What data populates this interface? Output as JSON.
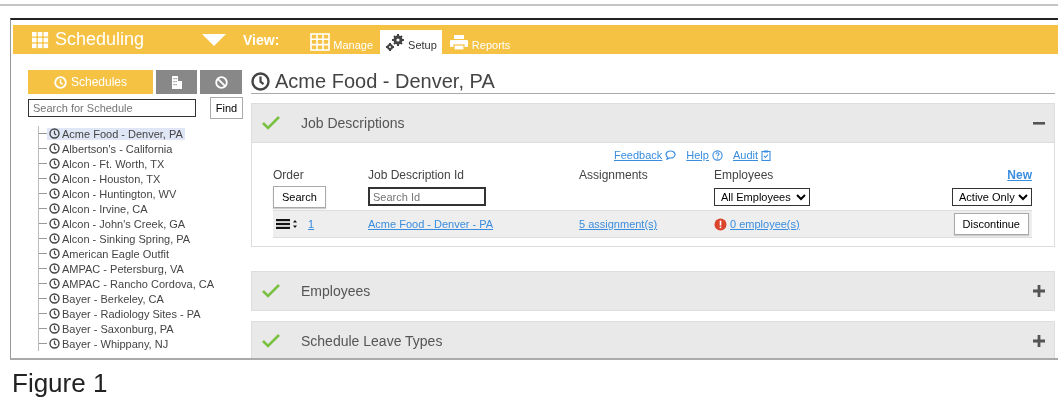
{
  "app": {
    "title": "Scheduling",
    "view_label": "View:",
    "view_tabs": [
      {
        "label": "Manage",
        "kind": "grid",
        "selected": false
      },
      {
        "label": "Setup",
        "kind": "gears",
        "selected": true
      },
      {
        "label": "Reports",
        "kind": "printer",
        "selected": false
      }
    ]
  },
  "sidebar": {
    "tabs": [
      {
        "kind": "text",
        "label": "Schedules",
        "selected": true
      },
      {
        "kind": "building",
        "selected": false
      },
      {
        "kind": "ban",
        "selected": false
      }
    ],
    "search": {
      "placeholder": "Search for Schedule"
    },
    "find_button": "Find",
    "items": [
      {
        "label": "Acme Food - Denver, PA",
        "selected": true
      },
      {
        "label": "Albertson's - California",
        "selected": false
      },
      {
        "label": "Alcon - Ft. Worth, TX",
        "selected": false
      },
      {
        "label": "Alcon - Houston, TX",
        "selected": false
      },
      {
        "label": "Alcon - Huntington, WV",
        "selected": false
      },
      {
        "label": "Alcon - Irvine, CA",
        "selected": false
      },
      {
        "label": "Alcon - John's Creek, GA",
        "selected": false
      },
      {
        "label": "Alcon - Sinking Spring, PA",
        "selected": false
      },
      {
        "label": "American Eagle Outfit",
        "selected": false
      },
      {
        "label": "AMPAC - Petersburg, VA",
        "selected": false
      },
      {
        "label": "AMPAC - Rancho Cordova, CA",
        "selected": false
      },
      {
        "label": "Bayer - Berkeley, CA",
        "selected": false
      },
      {
        "label": "Bayer - Radiology Sites - PA",
        "selected": false
      },
      {
        "label": "Bayer - Saxonburg, PA",
        "selected": false
      },
      {
        "label": "Bayer - Whippany, NJ",
        "selected": false
      }
    ]
  },
  "page_title": "Acme Food - Denver, PA",
  "sections": [
    {
      "title": "Job Descriptions",
      "complete": true,
      "expanded": true,
      "content": {
        "links": [
          {
            "label": "Feedback",
            "kind": "comment"
          },
          {
            "label": "Help",
            "kind": "help"
          },
          {
            "label": "Audit",
            "kind": "clipboard"
          }
        ],
        "columns": [
          "Order",
          "Job Description Id",
          "Assignments",
          "Employees"
        ],
        "new_link": "New",
        "search_button": "Search",
        "id_search": {
          "placeholder": "Search Id"
        },
        "employee_filter": "All Employees",
        "status_filter": "Active Only",
        "rows": [
          {
            "order": "1",
            "id": "Acme Food - Denver - PA",
            "assignments": "5 assignment(s)",
            "employees": "0 employee(s)",
            "warning": true,
            "action": "Discontinue"
          }
        ]
      }
    },
    {
      "title": "Employees",
      "complete": true,
      "expanded": false
    },
    {
      "title": "Schedule Leave Types",
      "complete": true,
      "expanded": false
    }
  ],
  "caption": "Figure 1"
}
